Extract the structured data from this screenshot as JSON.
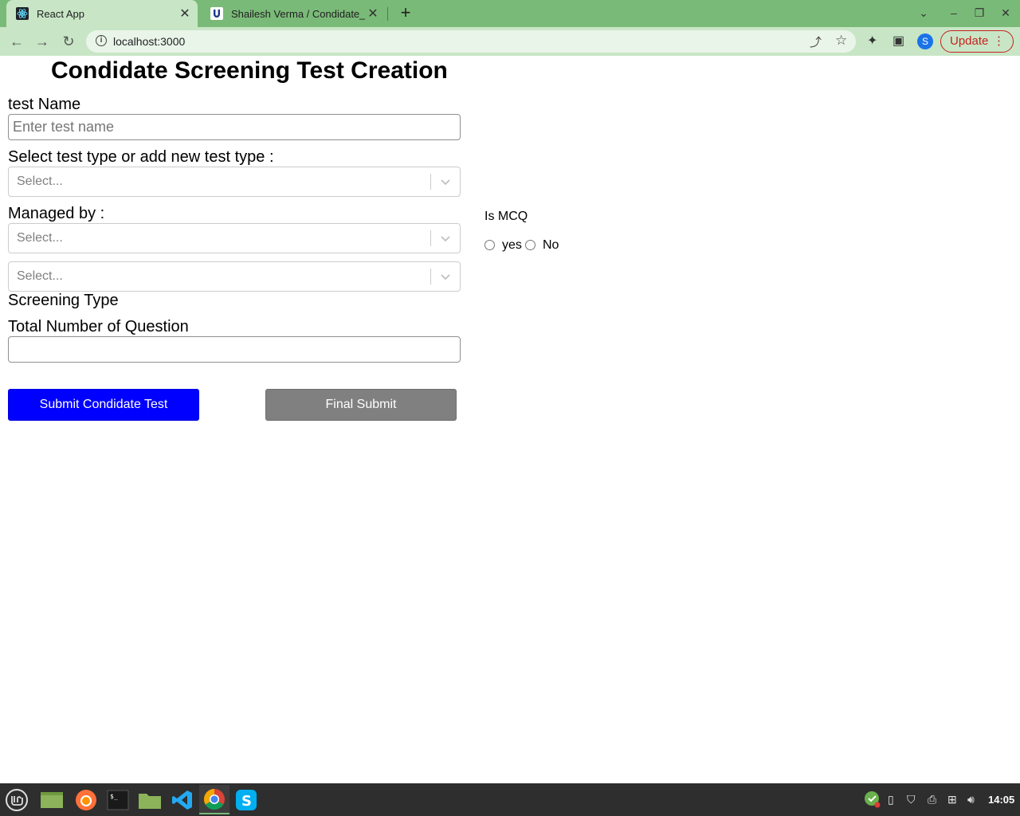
{
  "browser": {
    "tabs": [
      {
        "title": "React App",
        "active": true,
        "icon": "react-icon"
      },
      {
        "title": "Shailesh Verma / Condidate_s",
        "active": false,
        "icon": "github-u-icon"
      }
    ],
    "new_tab": "+",
    "url": "localhost:3000",
    "update_label": "Update",
    "avatar_letter": "S"
  },
  "form": {
    "title": "Condidate Screening Test Creation",
    "test_name_label": "test Name",
    "test_name_placeholder": "Enter test name",
    "test_type_label": "Select test type or add new test type :",
    "test_type_placeholder": "Select...",
    "managed_by_label": "Managed by :",
    "managed_by_placeholder": "Select...",
    "screening_type_placeholder": "Select...",
    "screening_type_label": "Screening Type",
    "total_questions_label": "Total Number of Question",
    "total_questions_value": "",
    "is_mcq_label": "Is MCQ",
    "mcq_yes": "yes",
    "mcq_no": "No",
    "submit_label": "Submit Condidate Test",
    "final_submit_label": "Final Submit"
  },
  "colors": {
    "chrome_tabbar": "#7aba78",
    "chrome_toolbar": "#c8e6c6",
    "submit_bg": "#0000ff",
    "final_bg": "#808080",
    "update_accent": "#c5221f"
  },
  "taskbar": {
    "apps": [
      "mint-menu-icon",
      "file-manager-icon",
      "firefox-icon",
      "terminal-icon",
      "folder-icon",
      "vscode-icon",
      "chrome-icon",
      "skype-icon"
    ],
    "clock": "14:05"
  }
}
